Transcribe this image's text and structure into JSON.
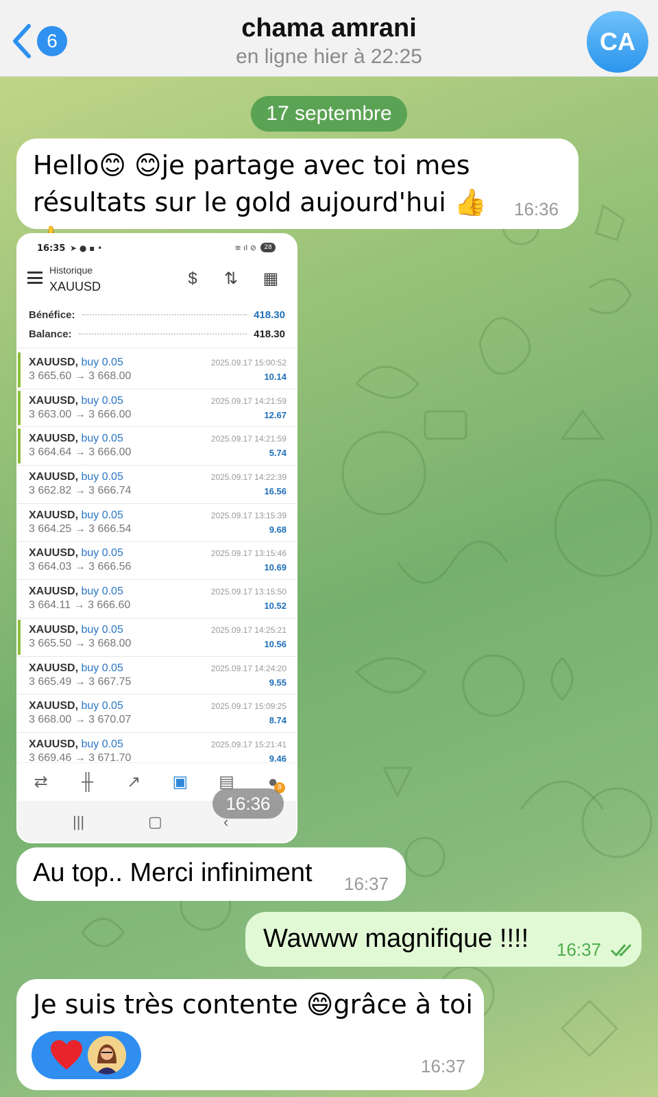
{
  "header": {
    "back_count": "6",
    "name": "chama amrani",
    "status": "en ligne hier à 22:25",
    "avatar_initials": "CA"
  },
  "date_separator": "17 septembre",
  "messages": [
    {
      "text": "Hello😊 😊je partage avec toi mes résultats sur le gold aujourd'hui 👍👍",
      "time": "16:36"
    },
    {
      "time": "16:36"
    },
    {
      "text": "Au top.. Merci infiniment",
      "time": "16:37"
    },
    {
      "text": "Wawww magnifique !!!!",
      "time": "16:37"
    },
    {
      "text": "Je suis très contente 😄grâce à toi",
      "time": "16:37"
    }
  ],
  "screenshot": {
    "status_time": "16:35",
    "battery": "28",
    "title": "Historique",
    "symbol": "XAUUSD",
    "profit_label": "Bénéfice:",
    "profit_value": "418.30",
    "balance_label": "Balance:",
    "balance_value": "418.30",
    "deals": [
      {
        "symbol": "XAUUSD,",
        "dir": "buy 0.05",
        "prices": "3 665.60 → 3 668.00",
        "datetime": "2025.09.17 15:00:52",
        "profit": "10.14",
        "marked": true
      },
      {
        "symbol": "XAUUSD,",
        "dir": "buy 0.05",
        "prices": "3 663.00 → 3 666.00",
        "datetime": "2025.09.17 14:21:59",
        "profit": "12.67",
        "marked": true
      },
      {
        "symbol": "XAUUSD,",
        "dir": "buy 0.05",
        "prices": "3 664.64 → 3 666.00",
        "datetime": "2025.09.17 14:21:59",
        "profit": "5.74",
        "marked": true
      },
      {
        "symbol": "XAUUSD,",
        "dir": "buy 0.05",
        "prices": "3 662.82 → 3 666.74",
        "datetime": "2025.09.17 14:22:39",
        "profit": "16.56",
        "marked": false
      },
      {
        "symbol": "XAUUSD,",
        "dir": "buy 0.05",
        "prices": "3 664.25 → 3 666.54",
        "datetime": "2025.09.17 13:15:39",
        "profit": "9.68",
        "marked": false
      },
      {
        "symbol": "XAUUSD,",
        "dir": "buy 0.05",
        "prices": "3 664.03 → 3 666.56",
        "datetime": "2025.09.17 13:15:46",
        "profit": "10.69",
        "marked": false
      },
      {
        "symbol": "XAUUSD,",
        "dir": "buy 0.05",
        "prices": "3 664.11 → 3 666.60",
        "datetime": "2025.09.17 13:15:50",
        "profit": "10.52",
        "marked": false
      },
      {
        "symbol": "XAUUSD,",
        "dir": "buy 0.05",
        "prices": "3 665.50 → 3 668.00",
        "datetime": "2025.09.17 14:25:21",
        "profit": "10.56",
        "marked": true
      },
      {
        "symbol": "XAUUSD,",
        "dir": "buy 0.05",
        "prices": "3 665.49 → 3 667.75",
        "datetime": "2025.09.17 14:24:20",
        "profit": "9.55",
        "marked": false
      },
      {
        "symbol": "XAUUSD,",
        "dir": "buy 0.05",
        "prices": "3 668.00 → 3 670.07",
        "datetime": "2025.09.17 15:09:25",
        "profit": "8.74",
        "marked": false
      },
      {
        "symbol": "XAUUSD,",
        "dir": "buy 0.05",
        "prices": "3 669.46 → 3 671.70",
        "datetime": "2025.09.17 15:21:41",
        "profit": "9.46",
        "marked": false
      }
    ],
    "tab_badge": "8"
  },
  "reactions": {
    "heart": "red-heart-icon",
    "user_avatar": "reaction-user-avatar"
  },
  "colors": {
    "accent": "#2f91f0",
    "outgoing_bubble": "#e2f9d6",
    "date_pill": "#54a050",
    "profit_blue": "#1f6fb8",
    "deal_marker": "#8cbf3a"
  },
  "icons": [
    "chevron-left-icon",
    "menu-icon",
    "dollar-exchange-icon",
    "sort-icon",
    "calendar-icon",
    "quotes-icon",
    "chart-icon",
    "trade-icon",
    "history-icon",
    "news-icon",
    "chat-icon",
    "read-checkmarks-icon"
  ]
}
